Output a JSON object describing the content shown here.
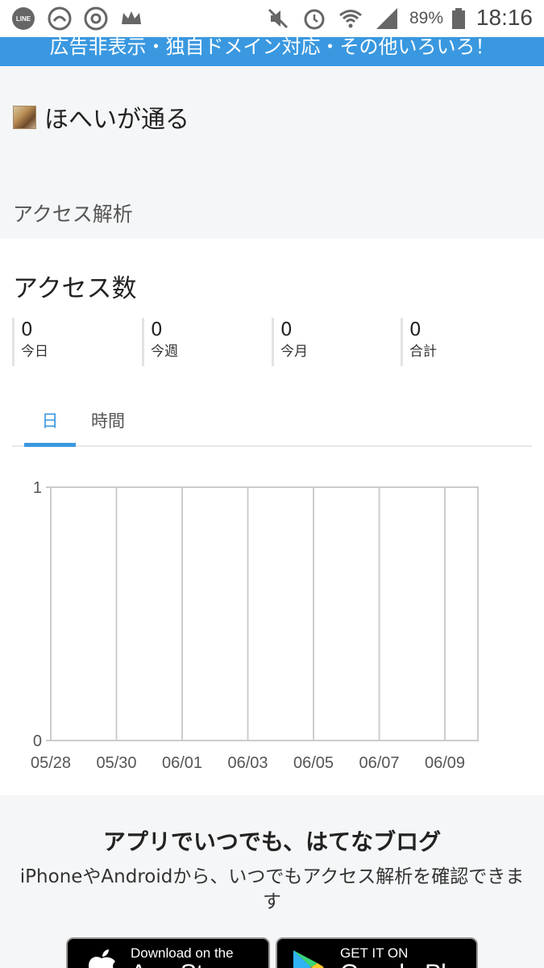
{
  "status_bar": {
    "left_icons": [
      "line-icon",
      "hands-icon",
      "chrome-icon",
      "crown-icon"
    ],
    "right_icons": [
      "mute-icon",
      "alarm-icon",
      "wifi-icon",
      "signal-icon",
      "battery-icon"
    ],
    "battery": "89%",
    "time": "18:16"
  },
  "banner": {
    "text": "広告非表示・独自ドメイン対応・その他いろいろ！"
  },
  "blog": {
    "name": "ほへいが通る"
  },
  "section": {
    "title": "アクセス解析"
  },
  "access": {
    "title": "アクセス数",
    "stats": [
      {
        "value": "0",
        "label": "今日"
      },
      {
        "value": "0",
        "label": "今週"
      },
      {
        "value": "0",
        "label": "今月"
      },
      {
        "value": "0",
        "label": "合計"
      }
    ]
  },
  "tabs": [
    {
      "label": "日",
      "active": true
    },
    {
      "label": "時間",
      "active": false
    }
  ],
  "chart_data": {
    "type": "bar",
    "categories": [
      "05/28",
      "05/30",
      "06/01",
      "06/03",
      "06/05",
      "06/07",
      "06/09"
    ],
    "values": [
      0,
      0,
      0,
      0,
      0,
      0,
      0
    ],
    "ylim": [
      0,
      1
    ],
    "yticks": [
      "1",
      "0"
    ],
    "grid": true
  },
  "promo": {
    "title": "アプリでいつでも、はてなブログ",
    "subtitle": "iPhoneやAndroidから、いつでもアクセス解析を確認できます"
  },
  "store_buttons": {
    "apple_small": "Download on the",
    "apple_big": "App Store",
    "google_small": "GET IT ON",
    "google_big": "Google Play"
  },
  "colors": {
    "accent": "#3a98e0",
    "background": "#f5f6f7",
    "panel": "#ffffff"
  }
}
